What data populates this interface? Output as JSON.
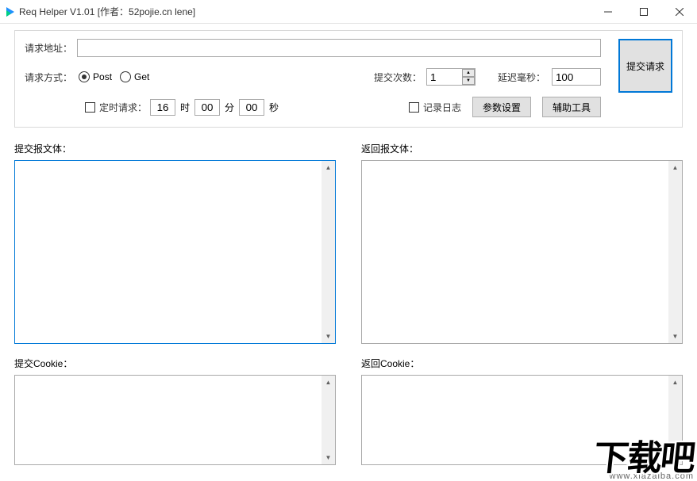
{
  "window": {
    "title": "Req Helper V1.01    [作者：52pojie.cn lene]"
  },
  "panel": {
    "url_label": "请求地址：",
    "url_value": "",
    "method_label": "请求方式：",
    "method_post": "Post",
    "method_get": "Get",
    "timed_label": "定时请求：",
    "time_hour": "16",
    "unit_hour": "时",
    "time_min": "00",
    "unit_min": "分",
    "time_sec": "00",
    "unit_sec": "秒",
    "count_label": "提交次数：",
    "count_value": "1",
    "delay_label": "延迟毫秒：",
    "delay_value": "100",
    "log_label": "记录日志",
    "param_btn": "参数设置",
    "tool_btn": "辅助工具",
    "submit": "提交请求"
  },
  "areas": {
    "req_body": "提交报文体：",
    "resp_body": "返回报文体：",
    "req_cookie": "提交Cookie：",
    "resp_cookie": "返回Cookie："
  },
  "watermark": {
    "text": "下载吧",
    "url": "www.xiazaiba.com"
  }
}
